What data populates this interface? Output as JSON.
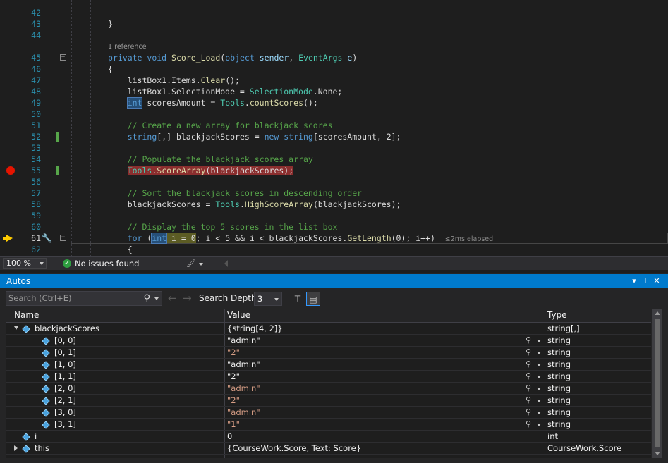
{
  "editor": {
    "lines": [
      {
        "n": "42",
        "html": ""
      },
      {
        "n": "43",
        "html": "}"
      },
      {
        "n": "44",
        "html": ""
      },
      {
        "n": "",
        "html": "1 reference",
        "lens": true
      },
      {
        "n": "45",
        "html": "<span class=\"kw\">private</span> <span class=\"kw\">void</span> <span class=\"fn\">Score_Load</span>(<span class=\"kw\">object</span> <span class=\"pm\">sender</span>, <span class=\"ty\">EventArgs</span> <span class=\"pm\">e</span>)"
      },
      {
        "n": "46",
        "html": "{"
      },
      {
        "n": "47",
        "html": "    listBox1.Items.<span class=\"fn\">Clear</span>();"
      },
      {
        "n": "48",
        "html": "    listBox1.SelectionMode = <span class=\"ty\">SelectionMode</span>.None;"
      },
      {
        "n": "49",
        "html": "    <span class=\"kw hl-ref\">int</span> scoresAmount = <span class=\"ty\">Tools</span>.<span class=\"fn\">countScores</span>();"
      },
      {
        "n": "50",
        "html": ""
      },
      {
        "n": "51",
        "html": "    <span class=\"cm\">// Create a new array for blackjack scores</span>"
      },
      {
        "n": "52",
        "html": "    <span class=\"kw\">string</span>[,] blackjackScores = <span class=\"kw\">new</span> <span class=\"kw\">string</span>[scoresAmount, 2];"
      },
      {
        "n": "53",
        "html": ""
      },
      {
        "n": "54",
        "html": "    <span class=\"cm\">// Populate the blackjack scores array</span>"
      },
      {
        "n": "55",
        "html": "    <span class=\"hl-bp\"><span class=\"ty\">Tools</span>.<span class=\"fn\">ScoreArray</span>(blackjackScores);</span>"
      },
      {
        "n": "56",
        "html": ""
      },
      {
        "n": "57",
        "html": "    <span class=\"cm\">// Sort the blackjack scores in descending order</span>"
      },
      {
        "n": "58",
        "html": "    blackjackScores = <span class=\"ty\">Tools</span>.<span class=\"fn\">HighScoreArray</span>(blackjackScores);"
      },
      {
        "n": "59",
        "html": ""
      },
      {
        "n": "60",
        "html": "    <span class=\"cm\">// Display the top 5 scores in the list box</span>"
      },
      {
        "n": "61",
        "html": "    <span class=\"kw\">for</span> (<span class=\"hl-cur\"><span class=\"kw hl-ref\">int</span> i = 0</span>; i &lt; 5 &amp;&amp; i &lt; blackjackScores.<span class=\"fn\">GetLength</span>(0); i++)  <span class=\"elapsed\">≤2ms elapsed</span>"
      },
      {
        "n": "62",
        "html": "    {"
      }
    ]
  },
  "status": {
    "zoom": "100 %",
    "issues": "No issues found"
  },
  "autos": {
    "title": "Autos",
    "search_placeholder": "Search (Ctrl+E)",
    "depth_label": "Search Depth:",
    "depth_value": "3",
    "columns": {
      "name": "Name",
      "value": "Value",
      "type": "Type"
    },
    "rows": [
      {
        "name": "blackjackScores",
        "value": "{string[4, 2]}",
        "type": "string[,]",
        "level": 0,
        "expander": "down",
        "str": false,
        "vis": false
      },
      {
        "name": "[0, 0]",
        "value": "\"admin\"",
        "type": "string",
        "level": 1,
        "expander": "",
        "str": false,
        "vis": true
      },
      {
        "name": "[0, 1]",
        "value": "\"2\"",
        "type": "string",
        "level": 1,
        "expander": "",
        "str": true,
        "vis": true
      },
      {
        "name": "[1, 0]",
        "value": "\"admin\"",
        "type": "string",
        "level": 1,
        "expander": "",
        "str": false,
        "vis": true
      },
      {
        "name": "[1, 1]",
        "value": "\"2\"",
        "type": "string",
        "level": 1,
        "expander": "",
        "str": false,
        "vis": true
      },
      {
        "name": "[2, 0]",
        "value": "\"admin\"",
        "type": "string",
        "level": 1,
        "expander": "",
        "str": true,
        "vis": true
      },
      {
        "name": "[2, 1]",
        "value": "\"2\"",
        "type": "string",
        "level": 1,
        "expander": "",
        "str": true,
        "vis": true
      },
      {
        "name": "[3, 0]",
        "value": "\"admin\"",
        "type": "string",
        "level": 1,
        "expander": "",
        "str": true,
        "vis": true
      },
      {
        "name": "[3, 1]",
        "value": "\"1\"",
        "type": "string",
        "level": 1,
        "expander": "",
        "str": true,
        "vis": true
      },
      {
        "name": "i",
        "value": "0",
        "type": "int",
        "level": 0,
        "expander": "",
        "str": false,
        "vis": false
      },
      {
        "name": "this",
        "value": "{CourseWork.Score, Text: Score}",
        "type": "CourseWork.Score",
        "level": 0,
        "expander": "right",
        "str": false,
        "vis": false
      }
    ]
  },
  "colors": {
    "accent": "#007acc",
    "breakpoint": "#e51400",
    "current_line_arrow": "#ffcc00",
    "changed_line": "#57a64a"
  }
}
